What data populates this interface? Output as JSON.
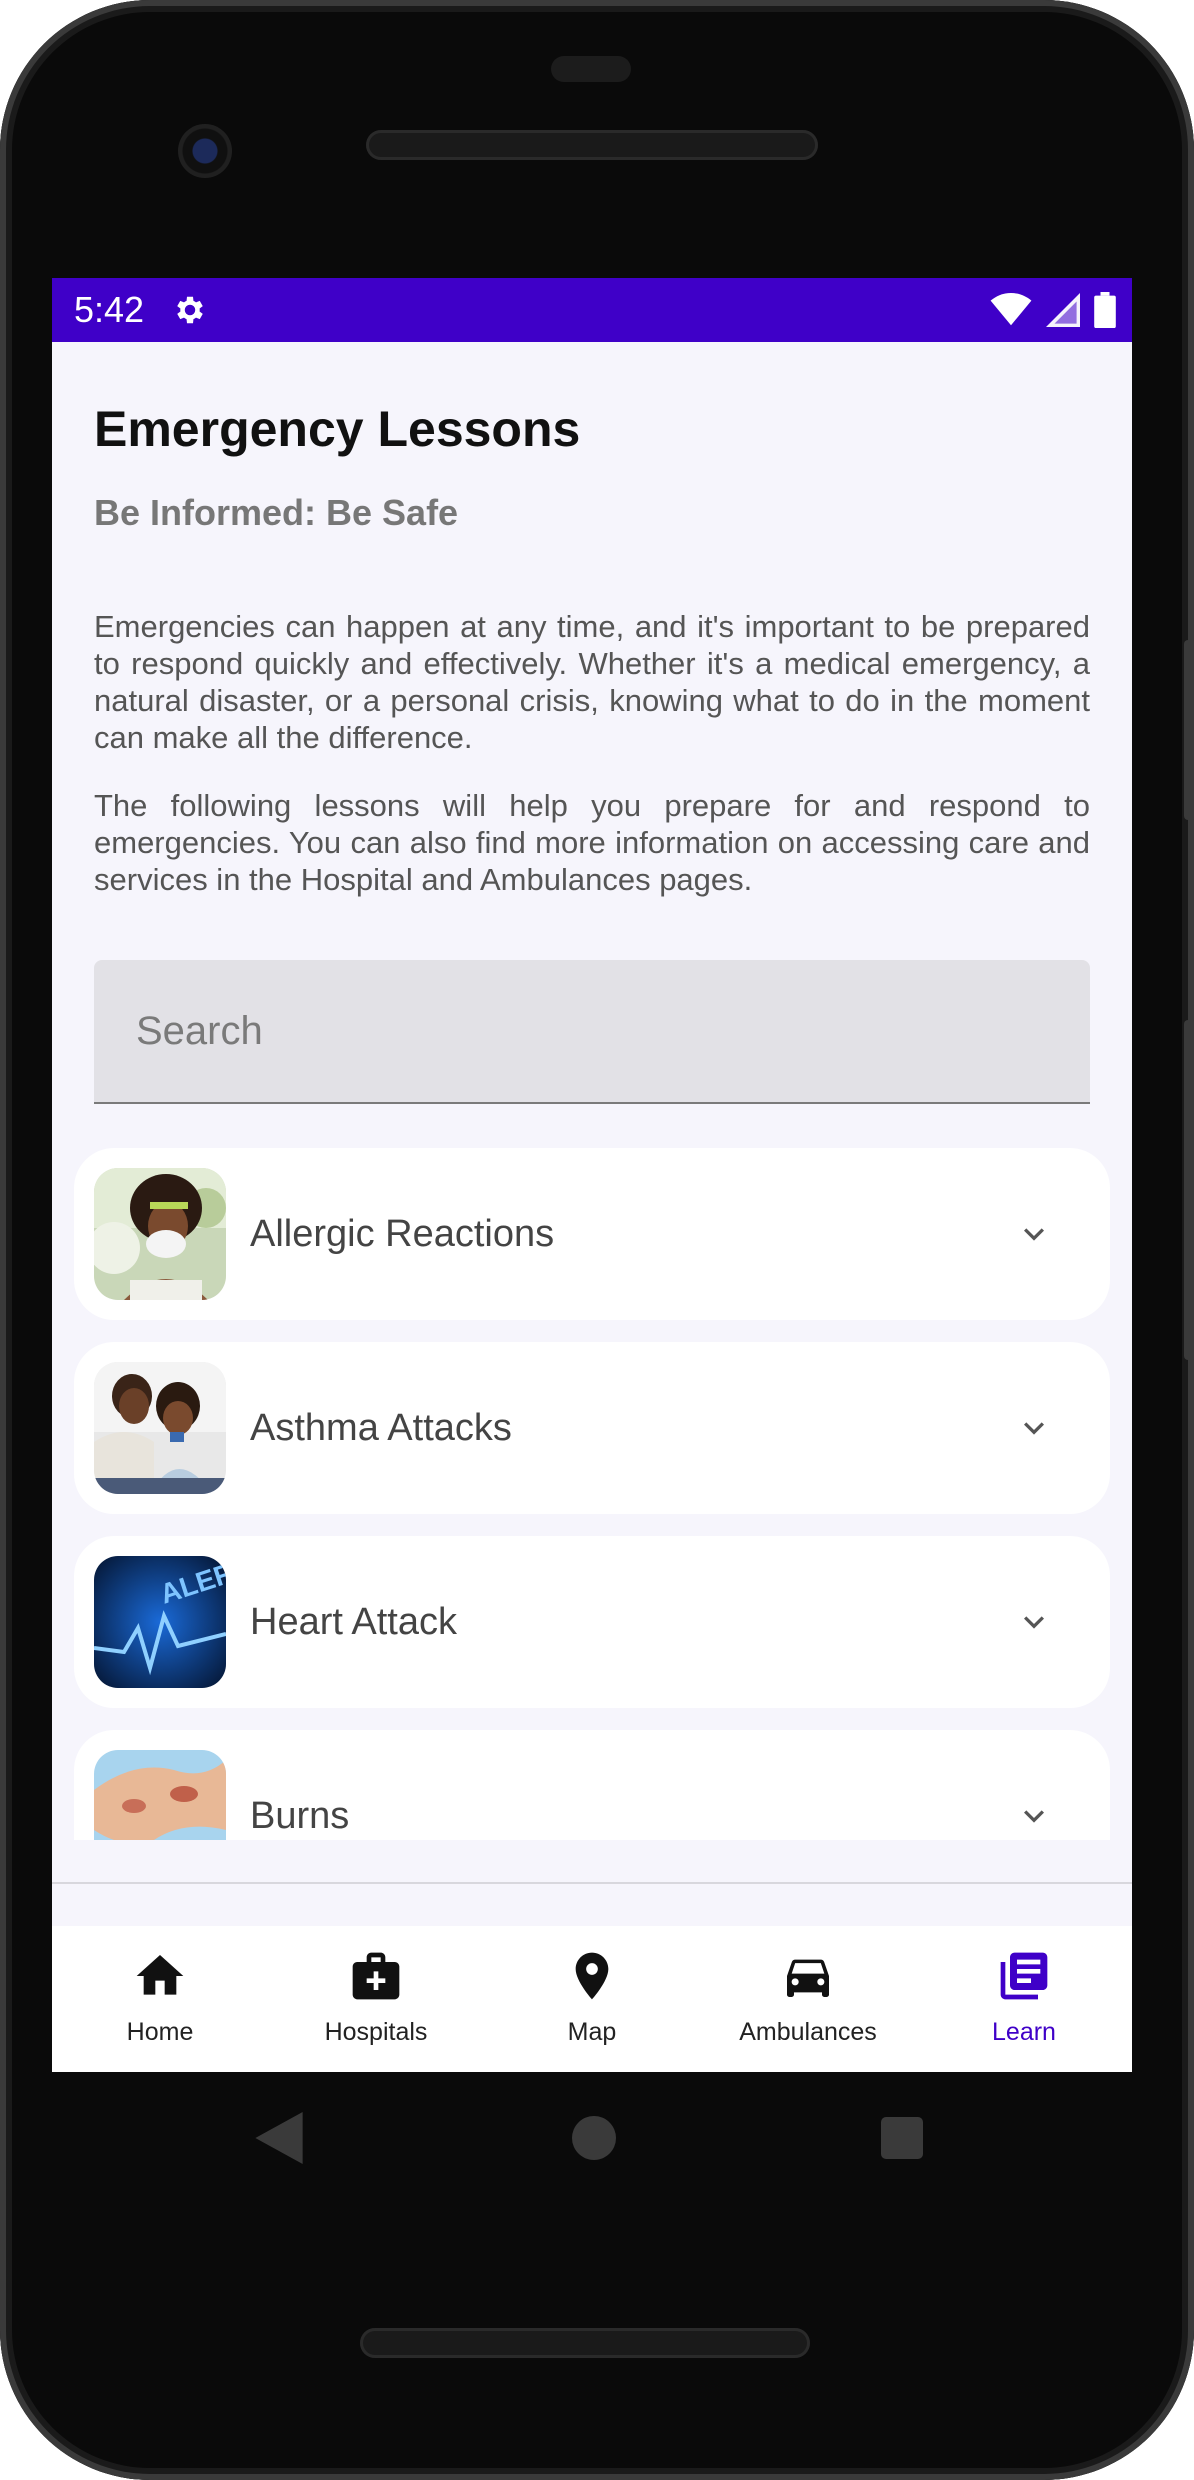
{
  "status_bar": {
    "time": "5:42",
    "bg_color": "#3f00c8",
    "icons": [
      "settings-gear-icon",
      "wifi-icon",
      "cell-signal-icon",
      "battery-icon"
    ]
  },
  "page": {
    "title": "Emergency Lessons",
    "subtitle": "Be Informed: Be Safe",
    "paragraph_1": "Emergencies can happen at any time, and it's important to be prepared to respond quickly and effectively. Whether it's a medical emergency, a natural disaster, or a personal crisis, knowing what to do in the moment can make all the difference.",
    "paragraph_2": "The following lessons will help you prepare for and respond to emergencies. You can also find more information on accessing care and services in the Hospital and Ambulances pages."
  },
  "search": {
    "placeholder": "Search",
    "value": ""
  },
  "lessons": [
    {
      "label": "Allergic Reactions",
      "thumbnail": "person-sneezing-photo",
      "expanded": false
    },
    {
      "label": "Asthma Attacks",
      "thumbnail": "parent-child-inhaler-photo",
      "expanded": false
    },
    {
      "label": "Heart Attack",
      "thumbnail": "blue-alert-heartbeat-photo",
      "expanded": false
    },
    {
      "label": "Burns",
      "thumbnail": "burned-hand-photo",
      "expanded": false
    }
  ],
  "bottom_nav": {
    "active": "Learn",
    "accent_color": "#3f00c8",
    "items": [
      {
        "label": "Home",
        "icon": "home-icon"
      },
      {
        "label": "Hospitals",
        "icon": "medical-bag-icon"
      },
      {
        "label": "Map",
        "icon": "map-pin-icon"
      },
      {
        "label": "Ambulances",
        "icon": "car-icon"
      },
      {
        "label": "Learn",
        "icon": "library-books-icon"
      }
    ]
  }
}
